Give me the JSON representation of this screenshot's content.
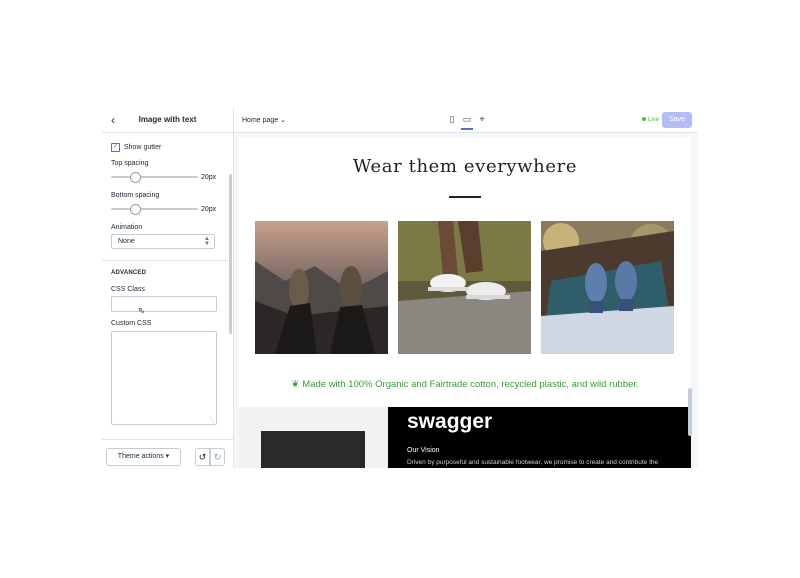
{
  "sidebar": {
    "title": "Image with text",
    "show_gutter": {
      "label": "Show gutter",
      "checked": true
    },
    "top_spacing": {
      "label": "Top spacing",
      "value": "20px",
      "level": 20
    },
    "bottom_spacing": {
      "label": "Bottom spacing",
      "value": "20px",
      "level": 20
    },
    "animation": {
      "label": "Animation",
      "value": "None"
    },
    "advanced_heading": "ADVANCED",
    "css_class": {
      "label": "CSS Class",
      "value": ""
    },
    "custom_css": {
      "label": "Custom CSS",
      "value": ""
    },
    "theme_actions": "Theme actions"
  },
  "topbar": {
    "page_select": "Home page",
    "devices": [
      "mobile-icon",
      "desktop-icon",
      "fullscreen-icon"
    ],
    "active_device": "desktop-icon",
    "status": "Live",
    "save": "Save"
  },
  "preview": {
    "headline": "Wear them everywhere",
    "tagline": "Made with 100% Organic and Fairtrade cotton, recycled plastic, and wild rubber.",
    "brand": "swagger",
    "vision_title": "Our Vision",
    "vision_text": "Driven by purposeful and sustainable footwear, we promise to create and contribute the"
  },
  "colors": {
    "accent": "#5c6ac4",
    "save_disabled": "#b3bcf5",
    "live_green": "#50b83c",
    "tagline_green": "#3a9a3a"
  }
}
